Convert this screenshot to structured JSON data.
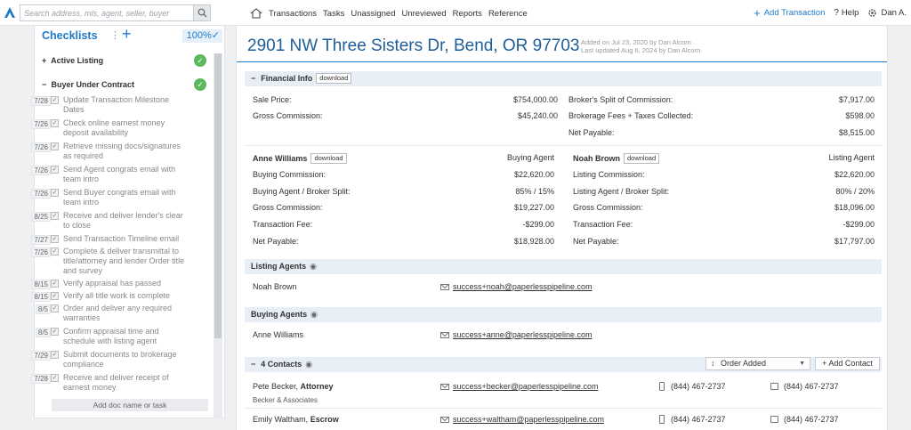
{
  "topbar": {
    "search_placeholder": "Search address, mls, agent, seller, buyer",
    "nav": [
      "Transactions",
      "Tasks",
      "Unassigned",
      "Unreviewed",
      "Reports",
      "Reference"
    ],
    "add_transaction": "Add Transaction",
    "help": "Help",
    "user": "Dan A."
  },
  "checklists": {
    "title": "Checklists",
    "percent": "100%",
    "sections": [
      "Active Listing",
      "Buyer Under Contract"
    ],
    "items": [
      {
        "text": "Update Transaction Milestone Dates",
        "date": "7/28"
      },
      {
        "text": "Check online earnest money deposit availability",
        "date": "7/26"
      },
      {
        "text": "Retrieve missing docs/signatures as required",
        "date": "7/26"
      },
      {
        "text": "Send Agent congrats email with team intro",
        "date": "7/26"
      },
      {
        "text": "Send Buyer congrats email with team intro",
        "date": "7/26"
      },
      {
        "text": "Receive and deliver lender's clear to close",
        "date": "8/25"
      },
      {
        "text": "Send Transaction Timeline email",
        "date": "7/27"
      },
      {
        "text": "Complete & deliver transmittal to title/attorney and lender Order title and survey",
        "date": "7/26"
      },
      {
        "text": "Verify appraisal has passed",
        "date": "8/15"
      },
      {
        "text": "Verify all title work is complete",
        "date": "8/15"
      },
      {
        "text": "Order and deliver any required warranties",
        "date": "8/5"
      },
      {
        "text": "Confirm appraisal time and schedule with listing agent",
        "date": "8/5"
      },
      {
        "text": "Submit documents to brokerage compliance",
        "date": "7/29"
      },
      {
        "text": "Receive and deliver receipt of earnest money",
        "date": "7/28"
      }
    ],
    "add_doc": "Add doc name or task"
  },
  "header": {
    "address": "2901 NW Three Sisters Dr, Bend, OR 97703",
    "added": "Added on Jul 23, 2020 by Dan Alcorn",
    "updated": "Last updated Aug 6, 2024 by Dan Alcorn"
  },
  "financial": {
    "title": "Financial Info",
    "download": "download",
    "sale_price_label": "Sale Price:",
    "sale_price": "$754,000.00",
    "gross_commission_label": "Gross Commission:",
    "gross_commission": "$45,240.00",
    "broker_split_label": "Broker's Split of Commission:",
    "broker_split": "$7,917.00",
    "brokerage_fees_label": "Brokerage Fees + Taxes Collected:",
    "brokerage_fees": "$598.00",
    "net_payable_label": "Net Payable:",
    "net_payable": "$8,515.00"
  },
  "agents_fin": [
    {
      "name": "Anne Williams",
      "role": "Buying Agent",
      "download": "download",
      "rows": [
        {
          "label": "Buying Commission:",
          "value": "$22,620.00"
        },
        {
          "label": "Buying Agent / Broker Split:",
          "value": "85% / 15%"
        },
        {
          "label": "Gross Commission:",
          "value": "$19,227.00"
        },
        {
          "label": "Transaction Fee:",
          "value": "-$299.00"
        },
        {
          "label": "Net Payable:",
          "value": "$18,928.00"
        }
      ]
    },
    {
      "name": "Noah Brown",
      "role": "Listing Agent",
      "download": "download",
      "rows": [
        {
          "label": "Listing Commission:",
          "value": "$22,620.00"
        },
        {
          "label": "Listing Agent / Broker Split:",
          "value": "80% / 20%"
        },
        {
          "label": "Gross Commission:",
          "value": "$18,096.00"
        },
        {
          "label": "Transaction Fee:",
          "value": "-$299.00"
        },
        {
          "label": "Net Payable:",
          "value": "$17,797.00"
        }
      ]
    }
  ],
  "listing_agents": {
    "title": "Listing Agents",
    "name": "Noah Brown",
    "email": "success+noah@paperlesspipeline.com"
  },
  "buying_agents": {
    "title": "Buying Agents",
    "name": "Anne Williams",
    "email": "success+anne@paperlesspipeline.com"
  },
  "contacts": {
    "title": "4 Contacts",
    "sort_label": "Order Added",
    "add_label": "+ Add Contact",
    "list": [
      {
        "name": "Pete Becker,",
        "role": "Attorney",
        "company": "Becker & Associates",
        "email": "success+becker@paperlesspipeline.com",
        "phone": "(844) 467-2737",
        "fax": "(844) 467-2737"
      },
      {
        "name": "Emily Waltham,",
        "role": "Escrow",
        "company": "",
        "email": "success+waltham@paperlesspipeline.com",
        "phone": "(844) 467-2737",
        "fax": "(844) 467-2737"
      }
    ]
  },
  "colors": {
    "accent": "#1e7ac9",
    "title": "#1e5d98",
    "band": "#e7eef5",
    "check": "#5cb85c"
  }
}
